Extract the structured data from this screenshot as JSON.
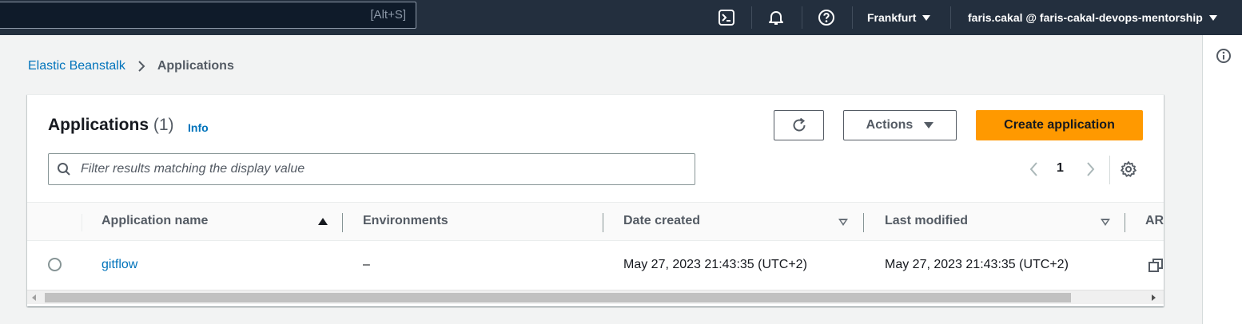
{
  "topnav": {
    "search_shortcut": "[Alt+S]",
    "region": "Frankfurt",
    "account": "faris.cakal @ faris-cakal-devops-mentorship",
    "icons": [
      "cloudshell-icon",
      "notifications-bell-icon",
      "help-icon"
    ]
  },
  "breadcrumb": {
    "parent": "Elastic Beanstalk",
    "current": "Applications"
  },
  "panel": {
    "title": "Applications",
    "count": "(1)",
    "info_label": "Info",
    "actions_label": "Actions",
    "create_label": "Create application",
    "filter_placeholder": "Filter results matching the display value",
    "page_number": "1"
  },
  "table": {
    "columns": [
      "Application name",
      "Environments",
      "Date created",
      "Last modified",
      "AR"
    ],
    "rows": [
      {
        "name": "gitflow",
        "environments": "–",
        "date_created": "May 27, 2023 21:43:35 (UTC+2)",
        "last_modified": "May 27, 2023 21:43:35 (UTC+2)"
      }
    ]
  },
  "colors": {
    "nav_bg": "#232f3e",
    "link": "#0073bb",
    "primary": "#ff9900",
    "page_bg": "#f2f3f3"
  }
}
